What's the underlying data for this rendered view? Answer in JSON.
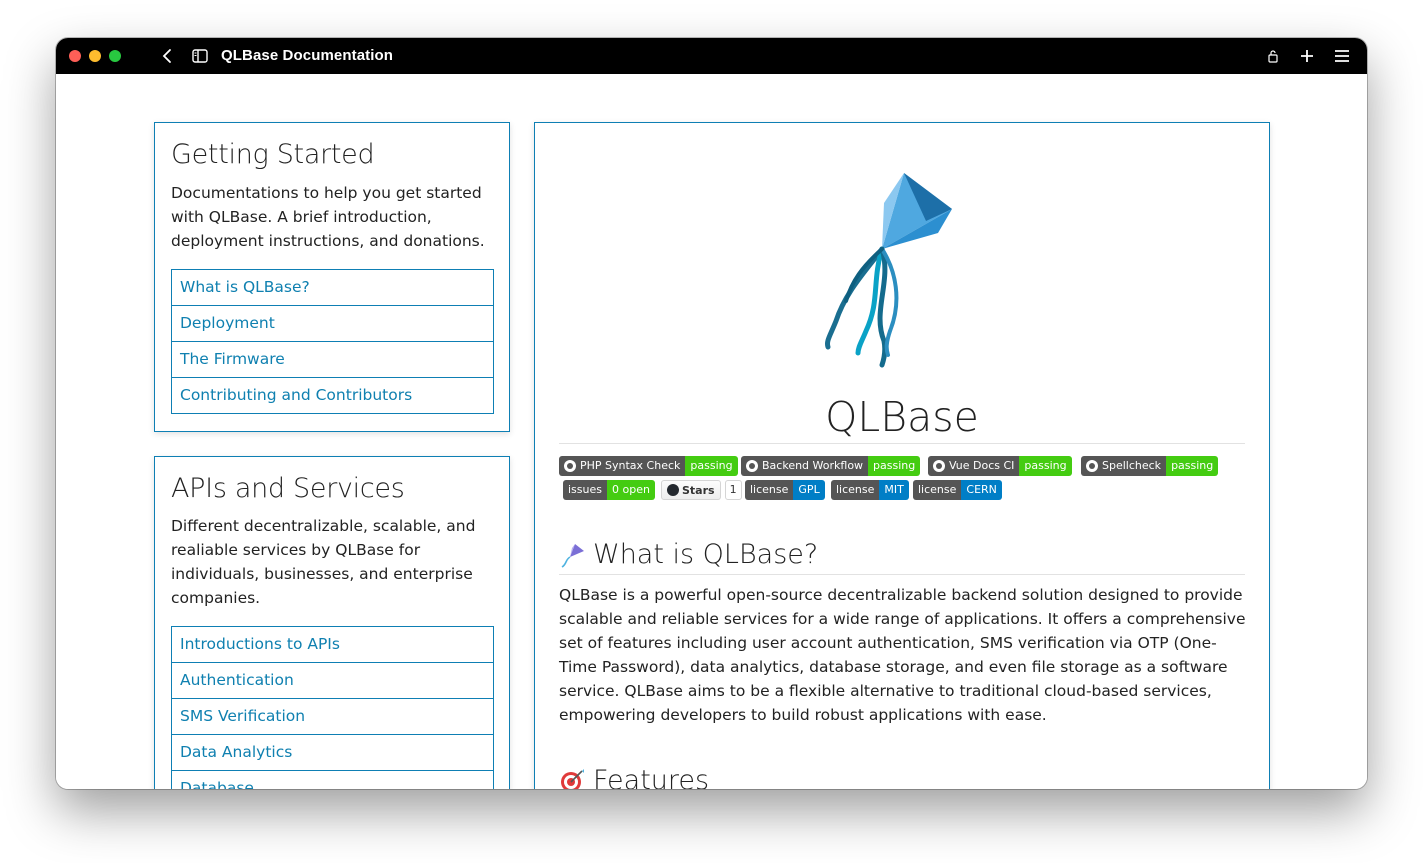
{
  "window": {
    "title": "QLBase Documentation"
  },
  "sidebar": {
    "getting_started": {
      "title": "Getting Started",
      "description": "Documentations to help you get started with QLBase. A brief introduction, deployment instructions, and donations.",
      "links": [
        "What is QLBase?",
        "Deployment",
        "The Firmware",
        "Contributing and Contributors"
      ]
    },
    "apis": {
      "title": "APIs and Services",
      "description": "Different decentralizable, scalable, and realiable services by QLBase for individuals, businesses, and enterprise companies.",
      "links": [
        "Introductions to APIs",
        "Authentication",
        "SMS Verification",
        "Data Analytics",
        "Database"
      ]
    }
  },
  "main": {
    "project_title": "QLBase",
    "badges_row1": [
      {
        "label": "PHP Syntax Check",
        "status": "passing"
      },
      {
        "label": "Backend Workflow",
        "status": "passing"
      },
      {
        "label": "Vue Docs CI",
        "status": "passing"
      },
      {
        "label": "Spellcheck",
        "status": "passing"
      }
    ],
    "badges_row2": {
      "issues": {
        "label": "issues",
        "value": "0 open"
      },
      "stars": {
        "label": "Stars",
        "count": "1"
      },
      "licenses": [
        {
          "label": "license",
          "value": "GPL"
        },
        {
          "label": "license",
          "value": "MIT"
        },
        {
          "label": "license",
          "value": "CERN"
        }
      ]
    },
    "what_is": {
      "heading": "What is QLBase?",
      "icon": "kite-icon",
      "paragraph": "QLBase is a powerful open-source decentralizable backend solution designed to provide scalable and reliable services for a wide range of applications. It offers a comprehensive set of features including user account authentication, SMS verification via OTP (One-Time Password), data analytics, database storage, and even file storage as a software service. QLBase aims to be a flexible alternative to traditional cloud-based services, empowering developers to build robust applications with ease."
    },
    "features": {
      "heading": "Features",
      "icon": "target-icon"
    }
  },
  "colors": {
    "accent": "#0e7fb4",
    "link": "#0f80b0",
    "badge_green": "#44cc11",
    "badge_blue": "#007ec6",
    "badge_gray": "#555555"
  }
}
